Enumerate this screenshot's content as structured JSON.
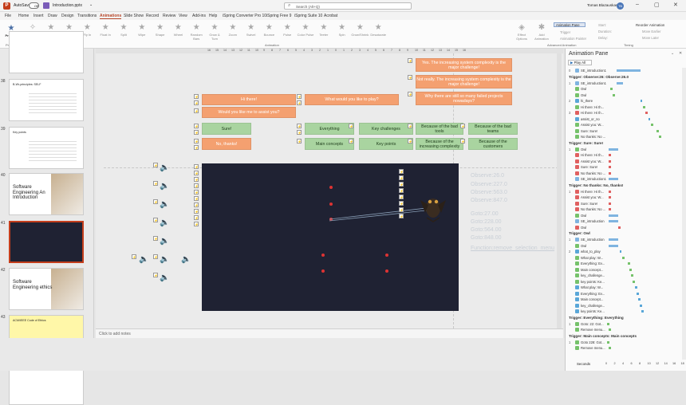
{
  "titlebar": {
    "autosave": "AutoSave",
    "toggle": "Off",
    "filename": "Introduction.pptx",
    "search_placeholder": "Search (Alt+Q)",
    "user": "Tomas Blazauskas",
    "user_initials": "TB",
    "record_label": "Record",
    "share_label": "Share"
  },
  "menu_tabs": [
    "File",
    "Home",
    "Insert",
    "Draw",
    "Design",
    "Transitions",
    "Animations",
    "Slide Show",
    "Record",
    "Review",
    "View",
    "Add-ins",
    "Help",
    "iSpring Converter Pro 10",
    "iSpring Free 9",
    "iSpring Suite 10",
    "Acrobat"
  ],
  "active_tab": "Animations",
  "ribbon": {
    "preview": "Preview",
    "preview_group": "Preview",
    "animations": [
      "None",
      "Appear",
      "Fade",
      "Fly In",
      "Float In",
      "Split",
      "Wipe",
      "Shape",
      "Wheel",
      "Random Bars",
      "Grow & Turn",
      "Zoom",
      "Swivel",
      "Bounce",
      "Pulse",
      "Color Pulse",
      "Teeter",
      "Spin",
      "Grow/Shrink",
      "Desaturate"
    ],
    "effect_options": "Effect Options",
    "animation_group": "Animation",
    "add_animation": "Add Animation",
    "animation_pane": "Animation Pane",
    "trigger": "Trigger",
    "animation_painter": "Animation Painter",
    "advanced_group": "Advanced Animation",
    "start": "Start:",
    "duration": "Duration:",
    "delay": "Delay:",
    "timing_group": "Timing",
    "reorder": "Reorder Animation",
    "move_earlier": "Move Earlier",
    "move_later": "Move Later"
  },
  "ruler_ticks": [
    "16",
    "15",
    "14",
    "13",
    "12",
    "11",
    "10",
    "9",
    "8",
    "7",
    "6",
    "5",
    "4",
    "3",
    "2",
    "1",
    "0",
    "1",
    "2",
    "3",
    "4",
    "5",
    "6",
    "7",
    "8",
    "9",
    "10",
    "11",
    "12",
    "13",
    "14",
    "15",
    "16"
  ],
  "thumbnails": [
    {
      "num": "",
      "title": "",
      "kind": "partial"
    },
    {
      "num": "38",
      "title": "B-Wr-principles: SELF",
      "kind": "text"
    },
    {
      "num": "39",
      "title": "Key points",
      "kind": "list"
    },
    {
      "num": "40",
      "title": "Software Engineering An Introduction",
      "kind": "cover"
    },
    {
      "num": "41",
      "title": "",
      "kind": "dark",
      "selected": true
    },
    {
      "num": "42",
      "title": "Software Engineering ethics",
      "kind": "cover"
    },
    {
      "num": "43",
      "title": "ACM/IEEE Code of Ethics",
      "kind": "yellow"
    },
    {
      "num": "44",
      "title": "",
      "kind": "partial"
    }
  ],
  "slide": {
    "orange_top_right": [
      "Yes. The increasing system complexity is the major challenge!",
      "Not really. The increasing system complexity is the major challenge!",
      "Why there are still so many failed projects nowadays?"
    ],
    "hi_there": "Hi there!",
    "what_play": "What would you like to play?",
    "assist": "Would you like me to assist you?",
    "sure": "Sure!",
    "no_thanks": "No, thanks!",
    "everything": "Everything",
    "key_challenges": "Key challenges",
    "main_concepts": "Main concepts",
    "key_points": "Key points",
    "green_right": [
      "Because of the bad tools",
      "Because of the bad teams",
      "Because of the increasing complexity",
      "Because of the customers"
    ],
    "observe": [
      "Observe:26.0",
      "Observe:227.0",
      "Observe:563.0",
      "Observe:847.0"
    ],
    "goto": [
      "Goto:27.00",
      "Goto:228.00",
      "Goto:564.00",
      "Goto:848.00"
    ],
    "function_line": "Function:remove_selection_menu"
  },
  "notes_placeholder": "Click to add notes",
  "pane": {
    "title": "Animation Pane",
    "play_all": "Play All",
    "rows": [
      {
        "t": "row",
        "num": "0",
        "label": "SE_introduction1",
        "color": "#7fb4e0",
        "bar": [
          60,
          30
        ],
        "barc": "#7fb4e0"
      },
      {
        "t": "title",
        "label": "Trigger: Observe:26: Observe:26.0"
      },
      {
        "t": "row",
        "num": "1",
        "label": "SE_introduction1",
        "color": "#7fb4e0",
        "bar": [
          60,
          8
        ],
        "barc": "#7fb4e0"
      },
      {
        "t": "row",
        "num": "",
        "label": "Owl",
        "color": "#76c26b",
        "bar": [
          52,
          3
        ],
        "barc": "#76c26b"
      },
      {
        "t": "row",
        "num": "",
        "label": "Owl",
        "color": "#76c26b",
        "bar": [
          55,
          3
        ],
        "barc": "#76c26b"
      },
      {
        "t": "row",
        "num": "2",
        "label": "hi_there",
        "color": "#5aa7d8",
        "bar": [
          90,
          2
        ],
        "barc": "#5aa7d8"
      },
      {
        "t": "row",
        "num": "",
        "label": "Hi there: Hi th...",
        "color": "#76c26b",
        "bar": [
          93,
          3
        ],
        "barc": "#76c26b"
      },
      {
        "t": "row",
        "num": "3",
        "label": "Hi there: Hi th...",
        "color": "#e06060",
        "bar": [
          96,
          3
        ],
        "barc": "#e06060"
      },
      {
        "t": "row",
        "num": "",
        "label": "assist_or_no",
        "color": "#5aa7d8",
        "bar": [
          100,
          2
        ],
        "barc": "#5aa7d8"
      },
      {
        "t": "row",
        "num": "",
        "label": "Assist you: W...",
        "color": "#76c26b",
        "bar": [
          103,
          3
        ],
        "barc": "#76c26b"
      },
      {
        "t": "row",
        "num": "",
        "label": "Sure: Sure!",
        "color": "#76c26b",
        "bar": [
          110,
          3
        ],
        "barc": "#76c26b"
      },
      {
        "t": "row",
        "num": "",
        "label": "No thanks: No ...",
        "color": "#76c26b",
        "bar": [
          113,
          3
        ],
        "barc": "#76c26b"
      },
      {
        "t": "title",
        "label": "Trigger: Sure: Sure!"
      },
      {
        "t": "row",
        "num": "1",
        "label": "Owl",
        "color": "#76c26b",
        "bar": [
          50,
          12
        ],
        "barc": "#7fb4e0"
      },
      {
        "t": "row",
        "num": "",
        "label": "Hi there: Hi th...",
        "color": "#e06060",
        "bar": [
          50,
          3
        ],
        "barc": "#e06060"
      },
      {
        "t": "row",
        "num": "",
        "label": "Assist you: W...",
        "color": "#e06060",
        "bar": [
          50,
          3
        ],
        "barc": "#e06060"
      },
      {
        "t": "row",
        "num": "",
        "label": "Sure: Sure!",
        "color": "#e06060",
        "bar": [
          50,
          3
        ],
        "barc": "#e06060"
      },
      {
        "t": "row",
        "num": "",
        "label": "No thanks: No ...",
        "color": "#e06060",
        "bar": [
          50,
          3
        ],
        "barc": "#e06060"
      },
      {
        "t": "row",
        "num": "",
        "label": "SE_introduction1",
        "color": "#7fb4e0",
        "bar": [
          50,
          12
        ],
        "barc": "#7fb4e0"
      },
      {
        "t": "title",
        "label": "Trigger: No thanks: No, thanks!"
      },
      {
        "t": "row",
        "num": "1",
        "label": "Hi there: Hi th...",
        "color": "#e06060",
        "bar": [
          50,
          3
        ],
        "barc": "#e06060"
      },
      {
        "t": "row",
        "num": "",
        "label": "Assist you: W...",
        "color": "#e06060",
        "bar": [
          50,
          3
        ],
        "barc": "#e06060"
      },
      {
        "t": "row",
        "num": "",
        "label": "Sure: Sure!",
        "color": "#e06060",
        "bar": [
          50,
          3
        ],
        "barc": "#e06060"
      },
      {
        "t": "row",
        "num": "",
        "label": "No thanks: No ...",
        "color": "#e06060",
        "bar": [
          50,
          3
        ],
        "barc": "#e06060"
      },
      {
        "t": "row",
        "num": "",
        "label": "Owl",
        "color": "#76c26b",
        "bar": [
          50,
          12
        ],
        "barc": "#7fb4e0"
      },
      {
        "t": "row",
        "num": "",
        "label": "SE_introduction",
        "color": "#7fb4e0",
        "bar": [
          50,
          12
        ],
        "barc": "#7fb4e0"
      },
      {
        "t": "row",
        "num": "",
        "label": "Owl",
        "color": "#e06060",
        "bar": [
          62,
          3
        ],
        "barc": "#e06060"
      },
      {
        "t": "title",
        "label": "Trigger: Owl"
      },
      {
        "t": "row",
        "num": "1",
        "label": "SE_introduction",
        "color": "#7fb4e0",
        "bar": [
          50,
          12
        ],
        "barc": "#7fb4e0"
      },
      {
        "t": "row",
        "num": "",
        "label": "Owl",
        "color": "#76c26b",
        "bar": [
          50,
          12
        ],
        "barc": "#7fb4e0"
      },
      {
        "t": "row",
        "num": "2",
        "label": "what_to_play",
        "color": "#5aa7d8",
        "bar": [
          64,
          2
        ],
        "barc": "#5aa7d8"
      },
      {
        "t": "row",
        "num": "",
        "label": "What play: W...",
        "color": "#76c26b",
        "bar": [
          67,
          3
        ],
        "barc": "#76c26b"
      },
      {
        "t": "row",
        "num": "",
        "label": "Everything: Ev...",
        "color": "#76c26b",
        "bar": [
          74,
          3
        ],
        "barc": "#76c26b"
      },
      {
        "t": "row",
        "num": "",
        "label": "Main concept...",
        "color": "#76c26b",
        "bar": [
          76,
          3
        ],
        "barc": "#76c26b"
      },
      {
        "t": "row",
        "num": "",
        "label": "key_challenge...",
        "color": "#76c26b",
        "bar": [
          78,
          3
        ],
        "barc": "#76c26b"
      },
      {
        "t": "row",
        "num": "",
        "label": "key points: Ke...",
        "color": "#76c26b",
        "bar": [
          80,
          3
        ],
        "barc": "#76c26b"
      },
      {
        "t": "row",
        "num": "",
        "label": "What play: W...",
        "color": "#5aa7d8",
        "bar": [
          83,
          3
        ],
        "barc": "#5aa7d8"
      },
      {
        "t": "row",
        "num": "",
        "label": "Everything: Ev...",
        "color": "#5aa7d8",
        "bar": [
          85,
          3
        ],
        "barc": "#5aa7d8"
      },
      {
        "t": "row",
        "num": "",
        "label": "Main concept...",
        "color": "#5aa7d8",
        "bar": [
          87,
          3
        ],
        "barc": "#5aa7d8"
      },
      {
        "t": "row",
        "num": "",
        "label": "key_challenge...",
        "color": "#5aa7d8",
        "bar": [
          89,
          3
        ],
        "barc": "#5aa7d8"
      },
      {
        "t": "row",
        "num": "",
        "label": "key points: Ke...",
        "color": "#5aa7d8",
        "bar": [
          91,
          3
        ],
        "barc": "#5aa7d8"
      },
      {
        "t": "title",
        "label": "Trigger: Everything: Everything"
      },
      {
        "t": "row",
        "num": "1",
        "label": "Goto: 22: Got...",
        "color": "#76c26b",
        "bar": [
          48,
          3
        ],
        "barc": "#76c26b"
      },
      {
        "t": "row",
        "num": "",
        "label": "Remove menu...",
        "color": "#76c26b",
        "bar": [
          50,
          3
        ],
        "barc": "#76c26b"
      },
      {
        "t": "title",
        "label": "Trigger: Main concepts: Main concepts"
      },
      {
        "t": "row",
        "num": "1",
        "label": "Goto 228: Got...",
        "color": "#76c26b",
        "bar": [
          48,
          3
        ],
        "barc": "#76c26b"
      },
      {
        "t": "row",
        "num": "",
        "label": "Remove menu...",
        "color": "#76c26b",
        "bar": [
          50,
          3
        ],
        "barc": "#76c26b"
      }
    ],
    "seconds": "Seconds",
    "scale": [
      "0",
      "2",
      "4",
      "6",
      "8",
      "10",
      "12",
      "14",
      "16",
      "18"
    ]
  },
  "colors": {
    "accent": "#b7472a",
    "orange_box": "#f4a070",
    "green_box": "#a9d4a0",
    "slide_bg": "#1f2233"
  }
}
